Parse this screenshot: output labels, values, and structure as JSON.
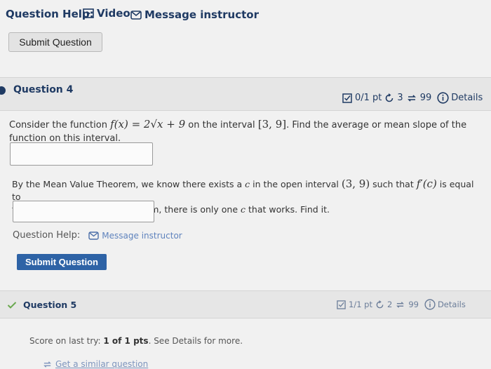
{
  "help_top": {
    "label": "Question Help:",
    "video_label": "Video",
    "message_label": "Message instructor"
  },
  "submit_top": {
    "label": "Submit Question"
  },
  "q4": {
    "title": "Question 4",
    "score": "0/1 pt",
    "retries": "3",
    "attempts": "99",
    "details_label": "Details",
    "prompt_a_pre": "Consider the function",
    "prompt_a_func": "f(x) = 2√x + 9",
    "prompt_a_mid": "on the interval",
    "prompt_a_interval": "[3, 9]",
    "prompt_a_post": ". Find the average or mean slope of the",
    "prompt_a_line2": "function on this interval.",
    "prompt_b_pre": "By the Mean Value Theorem, we know there exists a",
    "prompt_b_c": "c",
    "prompt_b_mid": "in the open interval",
    "prompt_b_interval": "(3, 9)",
    "prompt_b_post": "such that",
    "prompt_b_deriv": "f′(c)",
    "prompt_b_end": "is equal to",
    "prompt_b_line2_pre": "this mean slope. For this problem, there is only one",
    "prompt_b_line2_c": "c",
    "prompt_b_line2_post": "that works. Find it.",
    "answer1_value": "",
    "answer2_value": "",
    "help_label": "Question Help:",
    "message_label": "Message instructor",
    "submit_label": "Submit Question"
  },
  "q5": {
    "title": "Question 5",
    "score": "1/1 pt",
    "retries": "2",
    "attempts": "99",
    "details_label": "Details",
    "score_line_pre": "Score on last try:",
    "score_line_value": "1 of 1 pts",
    "score_line_post": ". See Details for more.",
    "similar_label": "Get a similar question"
  },
  "colors": {
    "accent_blue": "#2e63a6",
    "navy": "#1f3a63",
    "check_green": "#6aa84f"
  }
}
